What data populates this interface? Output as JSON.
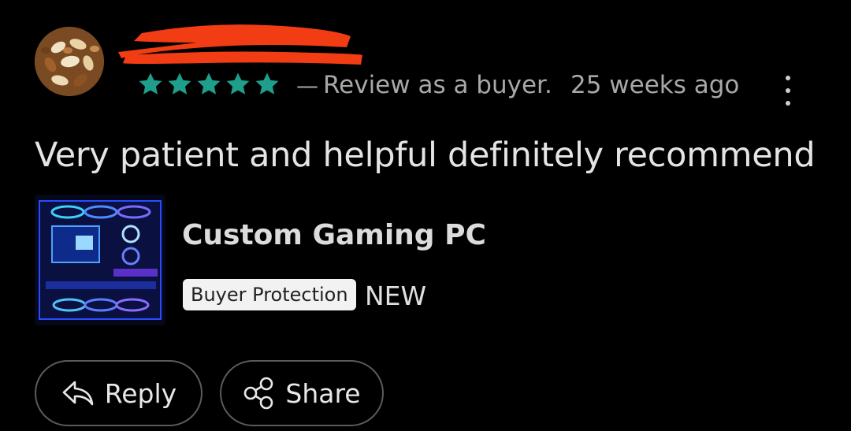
{
  "review": {
    "rating": 5,
    "rating_max": 5,
    "star_color": "#1f9e8c",
    "separator": "—",
    "meta": "Review as a buyer.",
    "time_ago": "25 weeks ago",
    "text": "Very patient and helpful definitely recommend"
  },
  "product": {
    "title": "Custom Gaming PC",
    "badge": "Buyer Protection",
    "condition": "NEW"
  },
  "actions": {
    "reply_label": "Reply",
    "share_label": "Share"
  },
  "icons": {
    "avatar": "nuts-photo-avatar",
    "more": "more-vertical-icon",
    "reply": "reply-arrow-icon",
    "share": "share-nodes-icon"
  }
}
